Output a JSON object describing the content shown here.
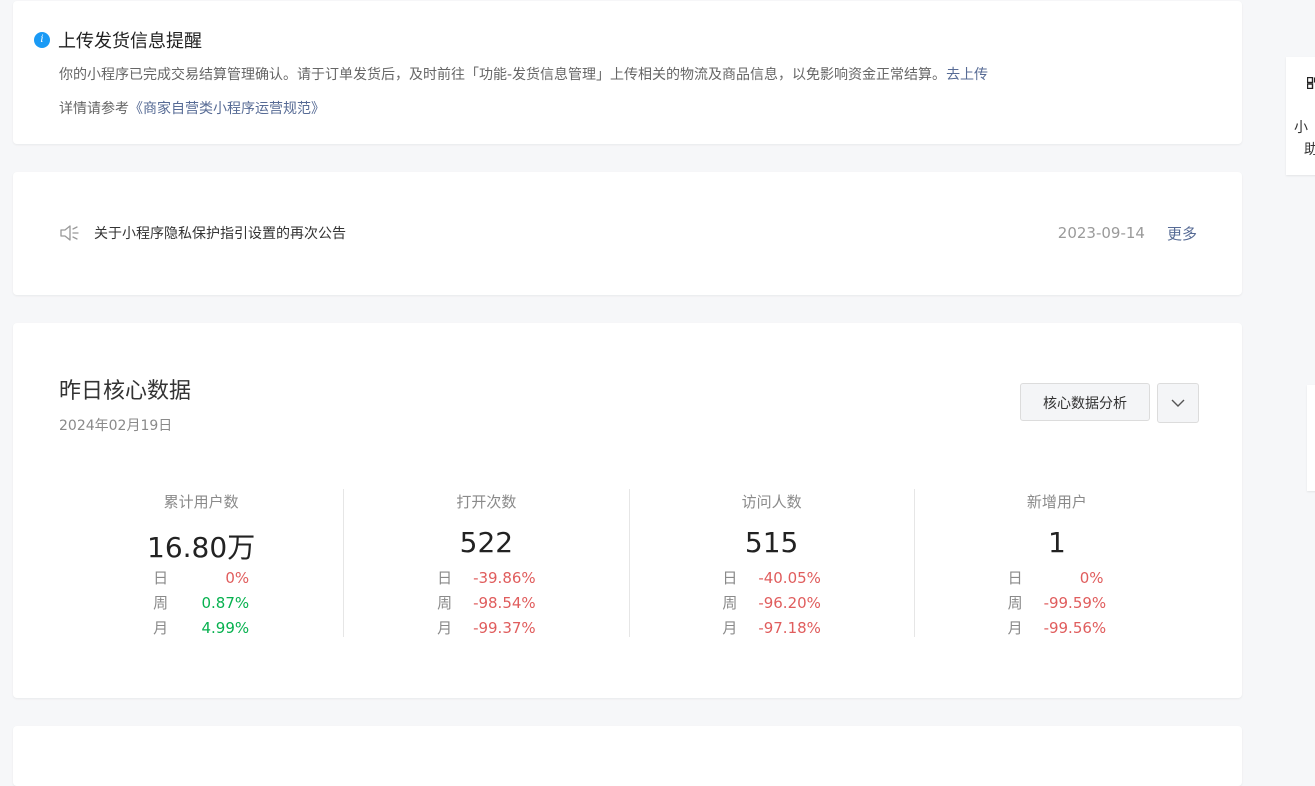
{
  "notice": {
    "title": "上传发货信息提醒",
    "line1_text": "你的小程序已完成交易结算管理确认。请于订单发货后，及时前往「功能-发货信息管理」上传相关的物流及商品信息，以免影响资金正常结算。",
    "line1_link": "去上传",
    "line2_text": "详情请参考",
    "line2_link": "《商家自营类小程序运营规范》"
  },
  "announcement": {
    "text": "关于小程序隐私保护指引设置的再次公告",
    "date": "2023-09-14",
    "more": "更多"
  },
  "core": {
    "title": "昨日核心数据",
    "date": "2024年02月19日",
    "analysis_button": "核心数据分析",
    "metrics": [
      {
        "label": "累计用户数",
        "value": "16.80万",
        "changes": [
          {
            "key": "日",
            "value": "0%",
            "color": "#e05d5d"
          },
          {
            "key": "周",
            "value": "0.87%",
            "color": "#07b14f"
          },
          {
            "key": "月",
            "value": "4.99%",
            "color": "#07b14f"
          }
        ]
      },
      {
        "label": "打开次数",
        "value": "522",
        "changes": [
          {
            "key": "日",
            "value": "-39.86%",
            "color": "#e05d5d"
          },
          {
            "key": "周",
            "value": "-98.54%",
            "color": "#e05d5d"
          },
          {
            "key": "月",
            "value": "-99.37%",
            "color": "#e05d5d"
          }
        ]
      },
      {
        "label": "访问人数",
        "value": "515",
        "changes": [
          {
            "key": "日",
            "value": "-40.05%",
            "color": "#e05d5d"
          },
          {
            "key": "周",
            "value": "-96.20%",
            "color": "#e05d5d"
          },
          {
            "key": "月",
            "value": "-97.18%",
            "color": "#e05d5d"
          }
        ]
      },
      {
        "label": "新增用户",
        "value": "1",
        "changes": [
          {
            "key": "日",
            "value": "0%",
            "color": "#e05d5d"
          },
          {
            "key": "周",
            "value": "-99.59%",
            "color": "#e05d5d"
          },
          {
            "key": "月",
            "value": "-99.56%",
            "color": "#e05d5d"
          }
        ]
      }
    ]
  },
  "side_panel": {
    "line1": "小",
    "line2": "助"
  },
  "colors": {
    "accent_link": "#576b95",
    "info_blue": "#1a9af5",
    "down_red": "#e05d5d",
    "up_green": "#07b14f"
  },
  "icons": [
    "info-icon",
    "speaker-icon",
    "chevron-down-icon",
    "qr-code-icon"
  ]
}
